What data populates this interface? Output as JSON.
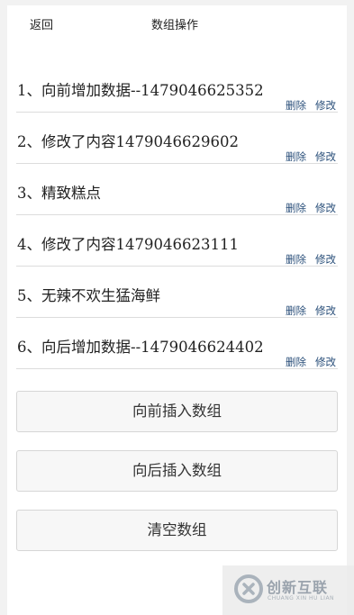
{
  "header": {
    "back_label": "返回",
    "title": "数组操作"
  },
  "items": [
    {
      "text": "1、向前增加数据--1479046625352",
      "delete_label": "删除",
      "edit_label": "修改"
    },
    {
      "text": "2、修改了内容1479046629602",
      "delete_label": "删除",
      "edit_label": "修改"
    },
    {
      "text": "3、精致糕点",
      "delete_label": "删除",
      "edit_label": "修改"
    },
    {
      "text": "4、修改了内容1479046623111",
      "delete_label": "删除",
      "edit_label": "修改"
    },
    {
      "text": "5、无辣不欢生猛海鲜",
      "delete_label": "删除",
      "edit_label": "修改"
    },
    {
      "text": "6、向后增加数据--1479046624402",
      "delete_label": "删除",
      "edit_label": "修改"
    }
  ],
  "buttons": {
    "prepend_label": "向前插入数组",
    "append_label": "向后插入数组",
    "clear_label": "清空数组"
  },
  "watermark": {
    "brand_cn": "创新互联",
    "brand_en": "CHUANG XIN HU LIAN"
  },
  "colors": {
    "action_link": "#2a4f7a",
    "background": "#f2f2f2",
    "panel": "#ffffff"
  }
}
